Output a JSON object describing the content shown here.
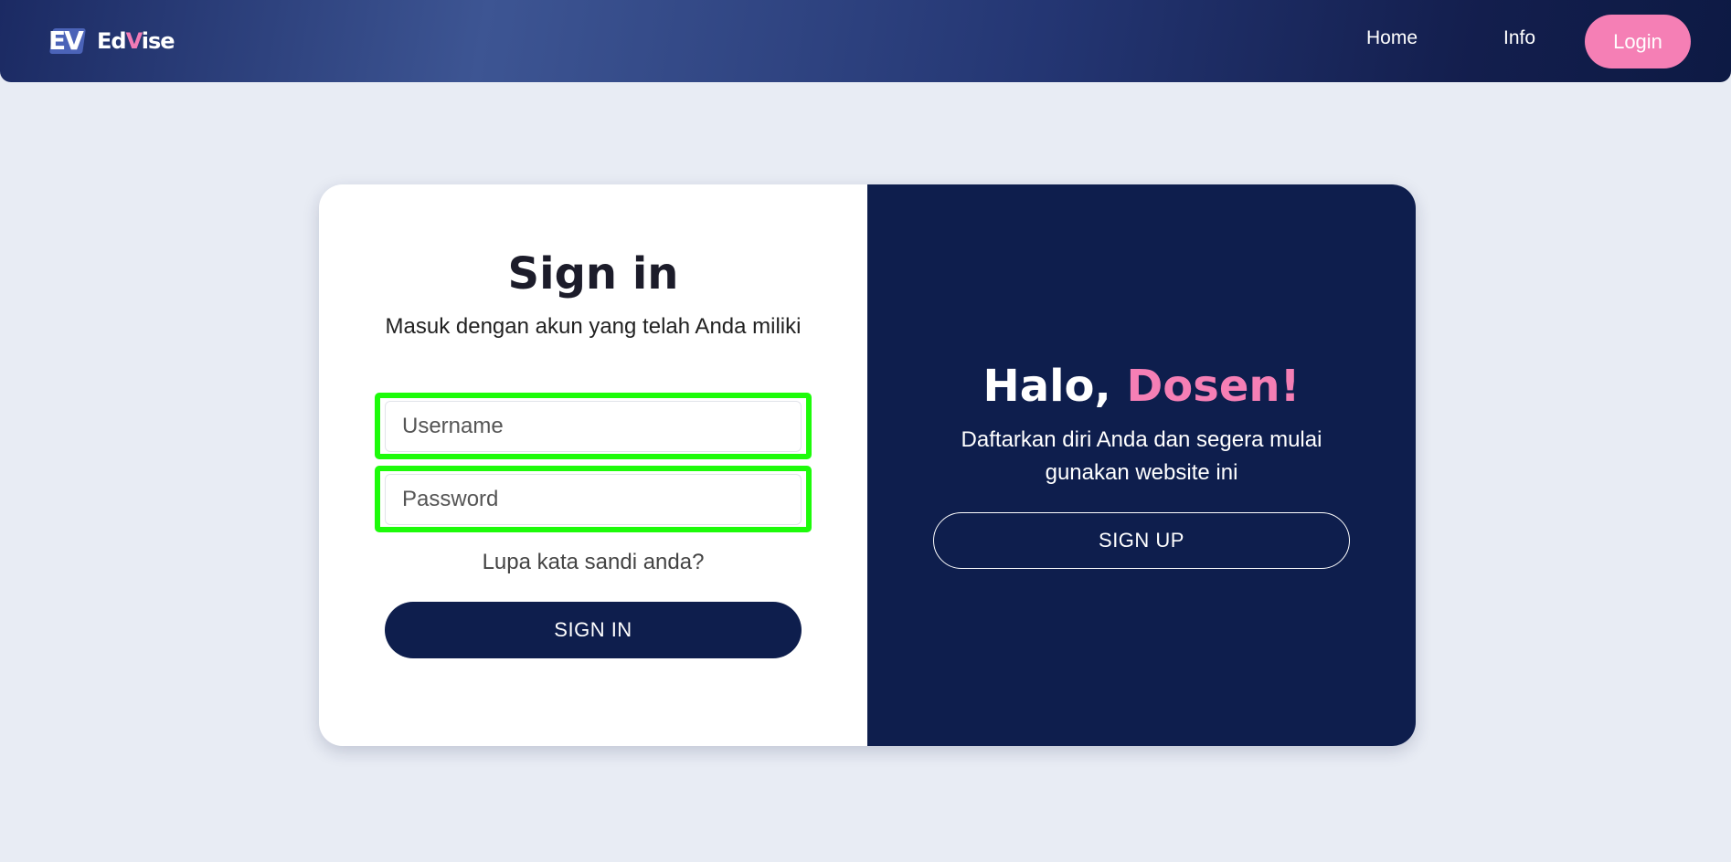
{
  "brand": {
    "name_part1": "Ed",
    "name_accent": "V",
    "name_part2": "ise",
    "logo_glyph": "EV"
  },
  "nav": {
    "home": "Home",
    "info": "Info",
    "login": "Login"
  },
  "signin": {
    "title": "Sign in",
    "subtitle": "Masuk dengan akun yang telah Anda miliki",
    "username_placeholder": "Username",
    "password_placeholder": "Password",
    "forgot": "Lupa kata sandi anda?",
    "button": "SIGN IN"
  },
  "panel": {
    "greeting": "Halo, ",
    "greeting_accent": "Dosen!",
    "subtitle": "Daftarkan diri Anda dan segera mulai gunakan website ini",
    "button": "SIGN UP"
  },
  "colors": {
    "navy": "#0e1e4d",
    "pink": "#f57fb5",
    "highlight": "#1dfb0a",
    "background": "#e8ecf4"
  }
}
